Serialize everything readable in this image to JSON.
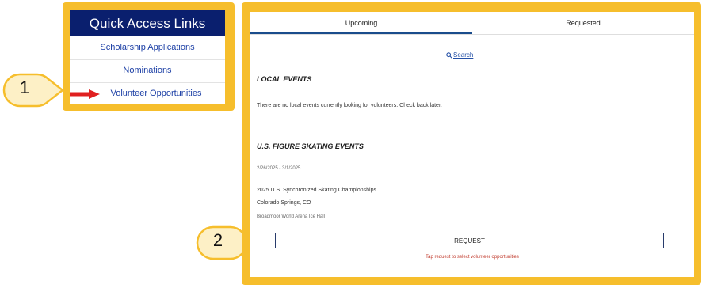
{
  "quick_access": {
    "title": "Quick Access Links",
    "links": [
      "Scholarship Applications",
      "Nominations",
      "Volunteer Opportunities"
    ]
  },
  "callouts": [
    "1",
    "2"
  ],
  "tabs": [
    "Upcoming",
    "Requested"
  ],
  "search": {
    "label": "Search"
  },
  "local": {
    "heading": "LOCAL EVENTS",
    "message": "There are no local events currently looking for volunteers. Check back later."
  },
  "usfs": {
    "heading": "U.S. FIGURE SKATING EVENTS",
    "event": {
      "dates": "2/26/2025 - 3/1/2025",
      "name": "2025 U.S. Synchronized Skating Championships",
      "location": "Colorado Springs, CO",
      "venue": "Broadmoor World Arena Ice Hall"
    },
    "request_label": "REQUEST",
    "hint": "Tap request to select volunteer opportunities"
  },
  "colors": {
    "frame": "#f6be2c",
    "header": "#0a1f6e",
    "link": "#1c3fa5",
    "arrow": "#e02020"
  }
}
